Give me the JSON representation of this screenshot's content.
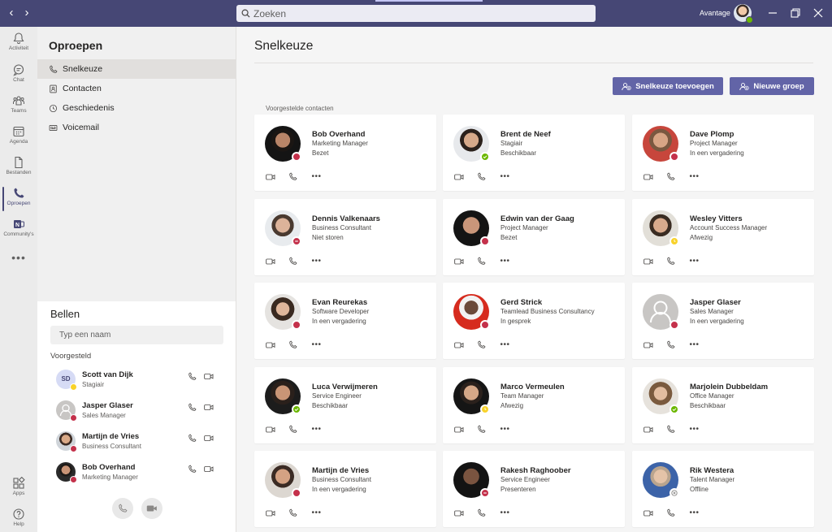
{
  "search": {
    "placeholder": "Zoeken"
  },
  "header": {
    "org_name": "Avantage"
  },
  "rail": [
    {
      "label": "Activiteit",
      "icon": "bell-icon"
    },
    {
      "label": "Chat",
      "icon": "chat-icon"
    },
    {
      "label": "Teams",
      "icon": "teams-icon"
    },
    {
      "label": "Agenda",
      "icon": "calendar-icon"
    },
    {
      "label": "Bestanden",
      "icon": "file-icon"
    },
    {
      "label": "Oproepen",
      "icon": "phone-icon",
      "active": true
    },
    {
      "label": "Community's",
      "icon": "community-icon"
    }
  ],
  "rail_bottom": [
    {
      "label": "Apps",
      "icon": "apps-icon"
    },
    {
      "label": "Help",
      "icon": "help-icon"
    }
  ],
  "panel": {
    "title": "Oproepen",
    "nav": [
      {
        "label": "Snelkeuze",
        "icon": "phone-icon",
        "active": true
      },
      {
        "label": "Contacten",
        "icon": "contacts-icon"
      },
      {
        "label": "Geschiedenis",
        "icon": "clock-icon"
      },
      {
        "label": "Voicemail",
        "icon": "voicemail-icon"
      }
    ]
  },
  "call": {
    "title": "Bellen",
    "input_placeholder": "Typ een naam",
    "suggested_label": "Voorgesteld",
    "suggested": [
      {
        "name": "Scott van Dijk",
        "role": "Stagiair",
        "initials": "SD",
        "status_color": "#f8d22a"
      },
      {
        "name": "Jasper Glaser",
        "role": "Sales Manager",
        "initials": "",
        "status_color": "#c4314b"
      },
      {
        "name": "Martijn de Vries",
        "role": "Business Consultant",
        "initials": "",
        "status_color": "#c4314b"
      },
      {
        "name": "Bob Overhand",
        "role": "Marketing Manager",
        "initials": "",
        "status_color": "#c4314b"
      }
    ]
  },
  "main": {
    "title": "Snelkeuze",
    "add_speed_dial_label": "Snelkeuze toevoegen",
    "new_group_label": "Nieuwe groep",
    "section_label": "Voorgestelde contacten"
  },
  "status_colors": {
    "busy": "#c4314b",
    "available": "#6bb700",
    "away": "#f8d22a",
    "offline": "#8a8886"
  },
  "contacts": [
    {
      "name": "Bob Overhand",
      "role": "Marketing Manager",
      "status": "Bezet",
      "status_type": "busy"
    },
    {
      "name": "Brent de Neef",
      "role": "Stagiair",
      "status": "Beschikbaar",
      "status_type": "available"
    },
    {
      "name": "Dave Plomp",
      "role": "Project Manager",
      "status": "In een vergadering",
      "status_type": "busy"
    },
    {
      "name": "Dennis Valkenaars",
      "role": "Business Consultant",
      "status": "Niet storen",
      "status_type": "dnd"
    },
    {
      "name": "Edwin van der Gaag",
      "role": "Project Manager",
      "status": "Bezet",
      "status_type": "busy"
    },
    {
      "name": "Wesley Vitters",
      "role": "Account Success Manager",
      "status": "Afwezig",
      "status_type": "away"
    },
    {
      "name": "Evan Reurekas",
      "role": "Software Developer",
      "status": "In een vergadering",
      "status_type": "busy"
    },
    {
      "name": "Gerd Strick",
      "role": "Teamlead Business Consultancy",
      "status": "In gesprek",
      "status_type": "busy"
    },
    {
      "name": "Jasper Glaser",
      "role": "Sales Manager",
      "status": "In een vergadering",
      "status_type": "busy"
    },
    {
      "name": "Luca Verwijmeren",
      "role": "Service Engineer",
      "status": "Beschikbaar",
      "status_type": "available"
    },
    {
      "name": "Marco Vermeulen",
      "role": "Team Manager",
      "status": "Afwezig",
      "status_type": "away"
    },
    {
      "name": "Marjolein Dubbeldam",
      "role": "Office Manager",
      "status": "Beschikbaar",
      "status_type": "available"
    },
    {
      "name": "Martijn de Vries",
      "role": "Business Consultant",
      "status": "In een vergadering",
      "status_type": "busy"
    },
    {
      "name": "Rakesh Raghoober",
      "role": "Service Engineer",
      "status": "Presenteren",
      "status_type": "dnd"
    },
    {
      "name": "Rik Westera",
      "role": "Talent Manager",
      "status": "Offline",
      "status_type": "offline"
    }
  ]
}
